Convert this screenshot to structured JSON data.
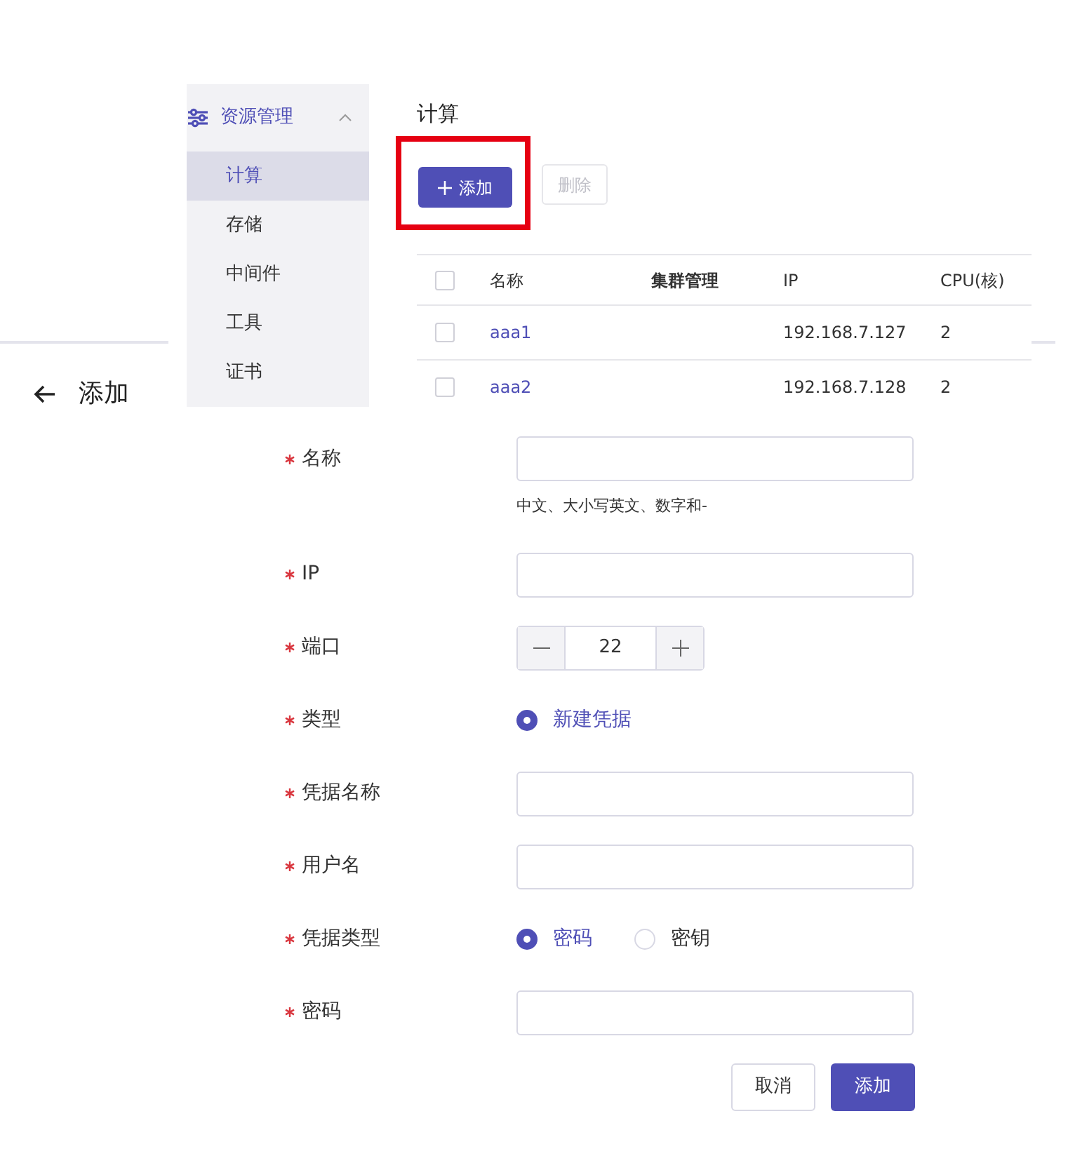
{
  "list_panel": {
    "sidebar": {
      "group": {
        "label": "资源管理",
        "expanded": true
      },
      "items": [
        {
          "label": "计算",
          "selected": true
        },
        {
          "label": "存储",
          "selected": false
        },
        {
          "label": "中间件",
          "selected": false
        },
        {
          "label": "工具",
          "selected": false
        },
        {
          "label": "证书",
          "selected": false
        }
      ]
    },
    "title": "计算",
    "toolbar": {
      "add_button": {
        "label": "添加",
        "highlighted": true
      },
      "delete_button": {
        "label": "删除",
        "disabled": true
      }
    },
    "table": {
      "all_checked": false,
      "columns": [
        "名称",
        "集群管理",
        "IP",
        "CPU(核)"
      ],
      "rows": [
        {
          "checked": false,
          "name": "aaa1",
          "ip": "192.168.7.127",
          "cpu": "2"
        },
        {
          "checked": false,
          "name": "aaa2",
          "ip": "192.168.7.128",
          "cpu": "2"
        }
      ]
    }
  },
  "form": {
    "title": "添加",
    "fields": [
      {
        "kind": "text",
        "label": "名称",
        "required": true,
        "hint": "中文、大小写英文、数字和-"
      },
      {
        "kind": "text",
        "label": "IP",
        "required": true
      },
      {
        "kind": "number",
        "label": "端口",
        "required": true,
        "value": "22"
      },
      {
        "kind": "radio",
        "label": "类型",
        "required": true,
        "options": [
          {
            "label": "新建凭据",
            "selected": true
          }
        ]
      },
      {
        "kind": "text",
        "label": "凭据名称",
        "required": true
      },
      {
        "kind": "text",
        "label": "用户名",
        "required": true
      },
      {
        "kind": "radio",
        "label": "凭据类型",
        "required": true,
        "options": [
          {
            "label": "密码",
            "selected": true
          },
          {
            "label": "密钥",
            "selected": false
          }
        ]
      },
      {
        "kind": "text",
        "label": "密码",
        "required": true
      }
    ],
    "buttons": [
      {
        "label": "取消",
        "primary": false
      },
      {
        "label": "添加",
        "primary": true
      }
    ]
  }
}
